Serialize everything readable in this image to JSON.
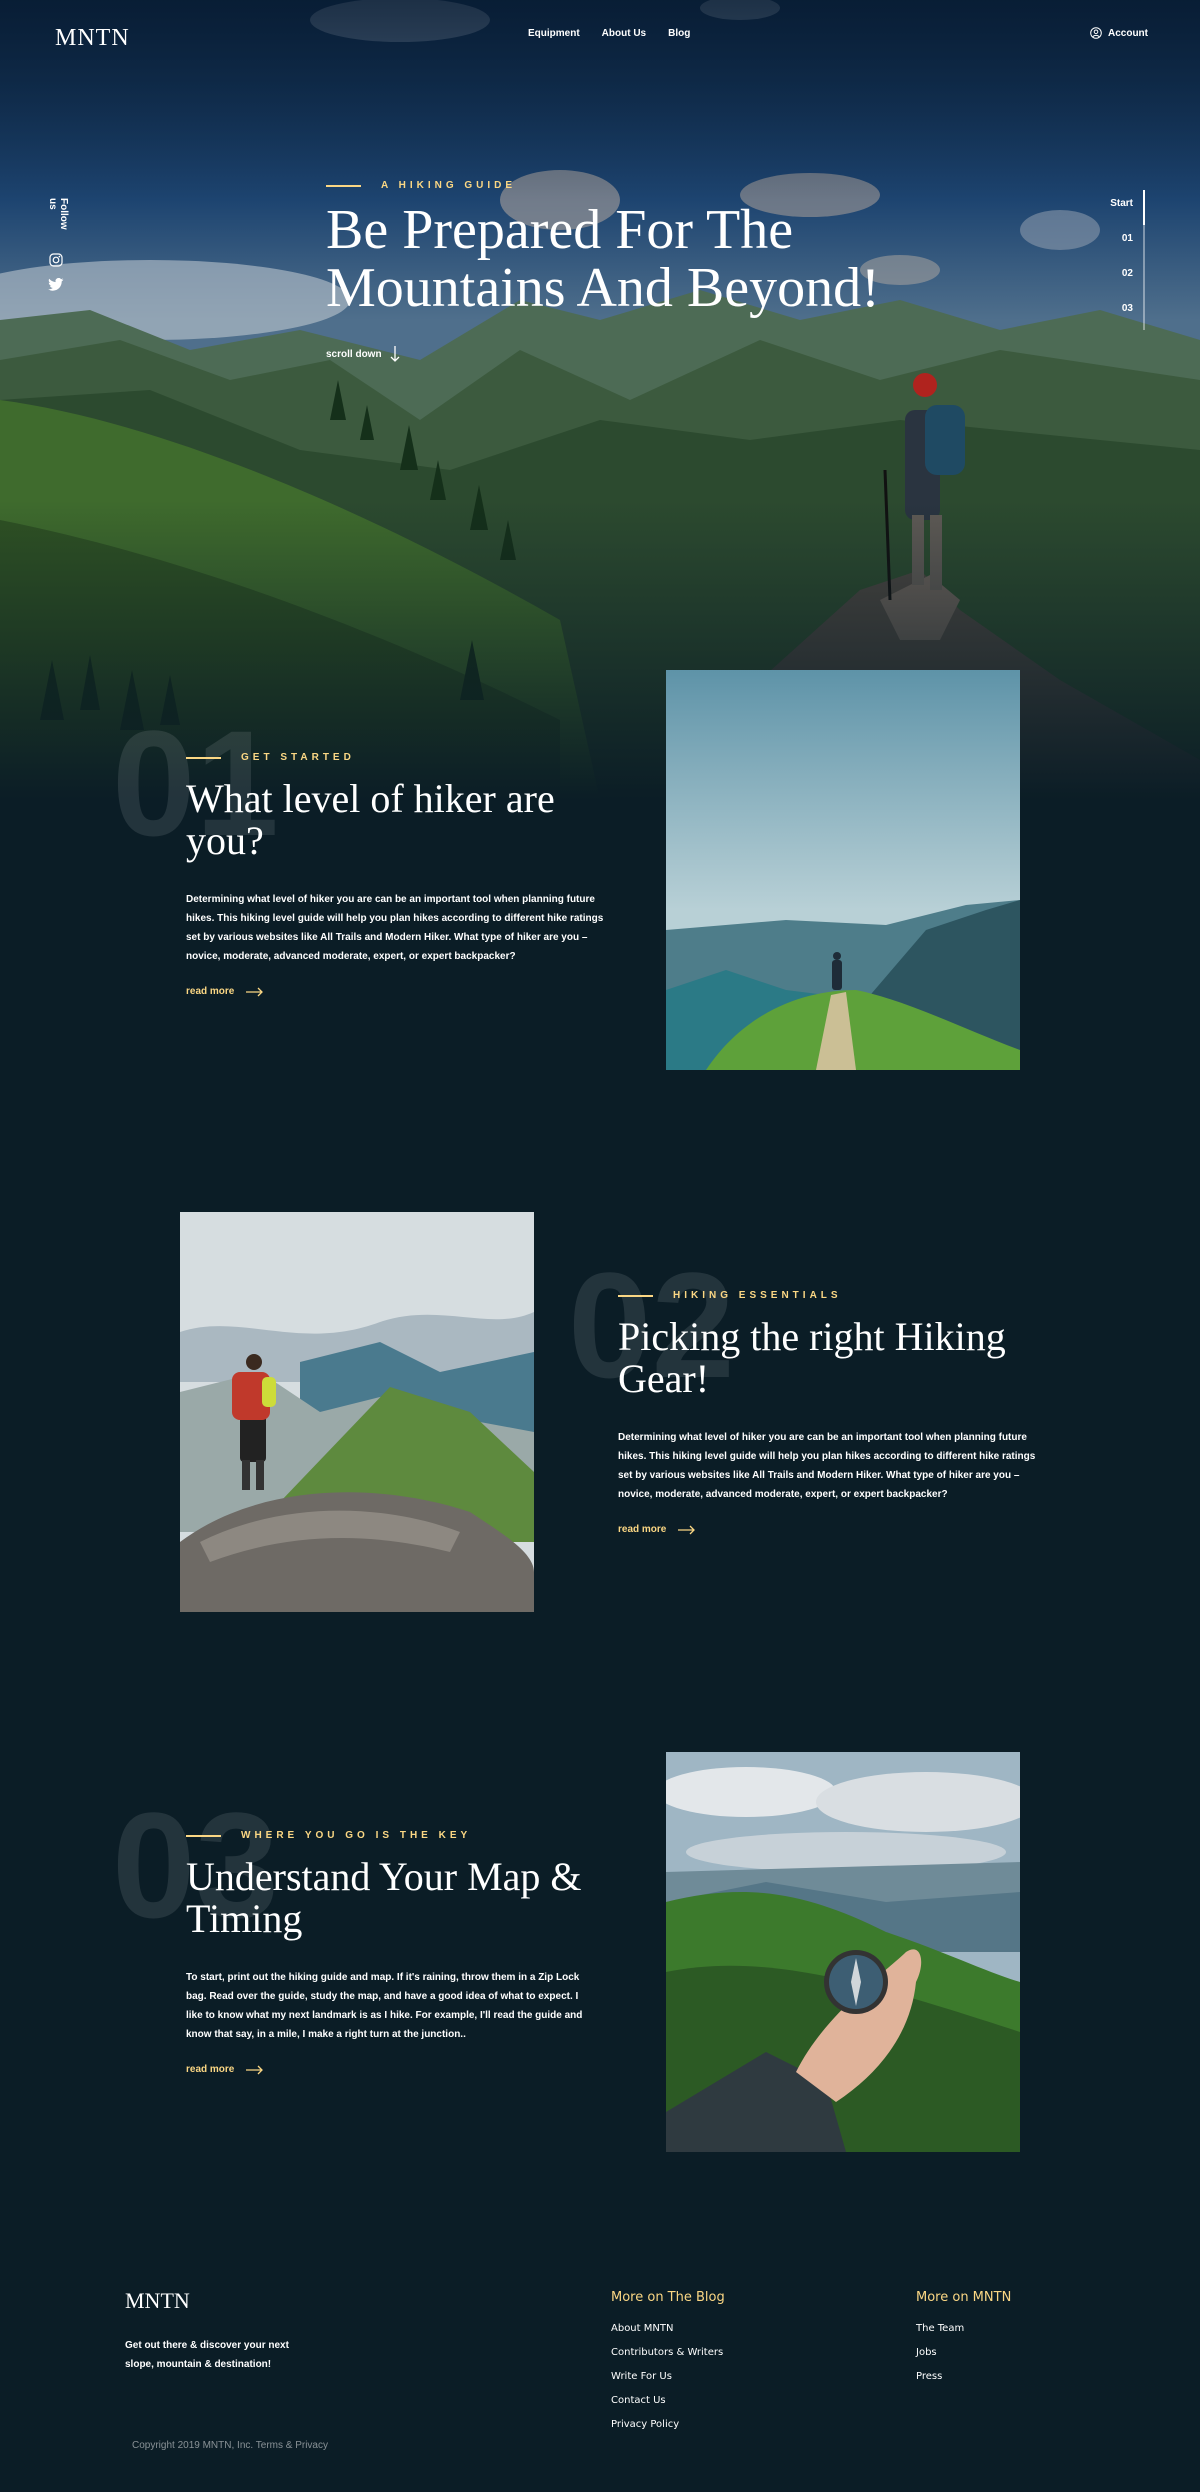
{
  "nav": {
    "logo": "MNTN",
    "links": [
      "Equipment",
      "About Us",
      "Blog"
    ],
    "account": "Account"
  },
  "social": {
    "follow_label": "Follow us",
    "icons": [
      "instagram-icon",
      "twitter-icon"
    ]
  },
  "hero": {
    "eyebrow": "A HIKING GUIDE",
    "title": "Be Prepared For The Mountains And Beyond!",
    "scroll": "scroll down"
  },
  "pager": {
    "items": [
      "Start",
      "01",
      "02",
      "03"
    ],
    "active": "Start"
  },
  "sections": [
    {
      "number": "01",
      "eyebrow": "GET STARTED",
      "title": "What level of hiker are you?",
      "body": "Determining what level of hiker you are can be an important tool when planning future hikes. This hiking level guide will help you plan hikes according to different hike ratings set by various websites like All Trails and Modern Hiker. What type of hiker are you – novice, moderate, advanced moderate, expert, or expert backpacker?",
      "link": "read more"
    },
    {
      "number": "02",
      "eyebrow": "HIKING ESSENTIALS",
      "title": "Picking the right Hiking Gear!",
      "body": "Determining what level of hiker you are can be an important tool when planning future hikes. This hiking level guide will help you plan hikes according to different hike ratings set by various websites like All Trails and Modern Hiker. What type of hiker are you – novice, moderate, advanced moderate, expert, or expert backpacker?",
      "link": "read more"
    },
    {
      "number": "03",
      "eyebrow": "WHERE YOU GO IS THE KEY",
      "title": "Understand Your Map & Timing",
      "body": "To start, print out the hiking guide and map. If it's raining, throw them in a Zip Lock bag. Read over the guide, study the map, and have a good idea of what to expect. I like to know what my next landmark is as I hike. For example, I'll read the guide and know that say, in a mile, I make a right turn at the junction..",
      "link": "read more"
    }
  ],
  "footer": {
    "logo": "MNTN",
    "tagline": "Get out there & discover your next slope, mountain & destination!",
    "copyright": "Copyright 2019 MNTN, Inc. Terms & Privacy",
    "blog": {
      "heading": "More on The Blog",
      "links": [
        "About MNTN",
        "Contributors & Writers",
        "Write For Us",
        "Contact Us",
        "Privacy Policy"
      ]
    },
    "mntn": {
      "heading": "More on MNTN",
      "links": [
        "The Team",
        "Jobs",
        "Press"
      ]
    }
  },
  "colors": {
    "background": "#0b1d26",
    "accent": "#fbd784",
    "text": "#ffffff"
  }
}
